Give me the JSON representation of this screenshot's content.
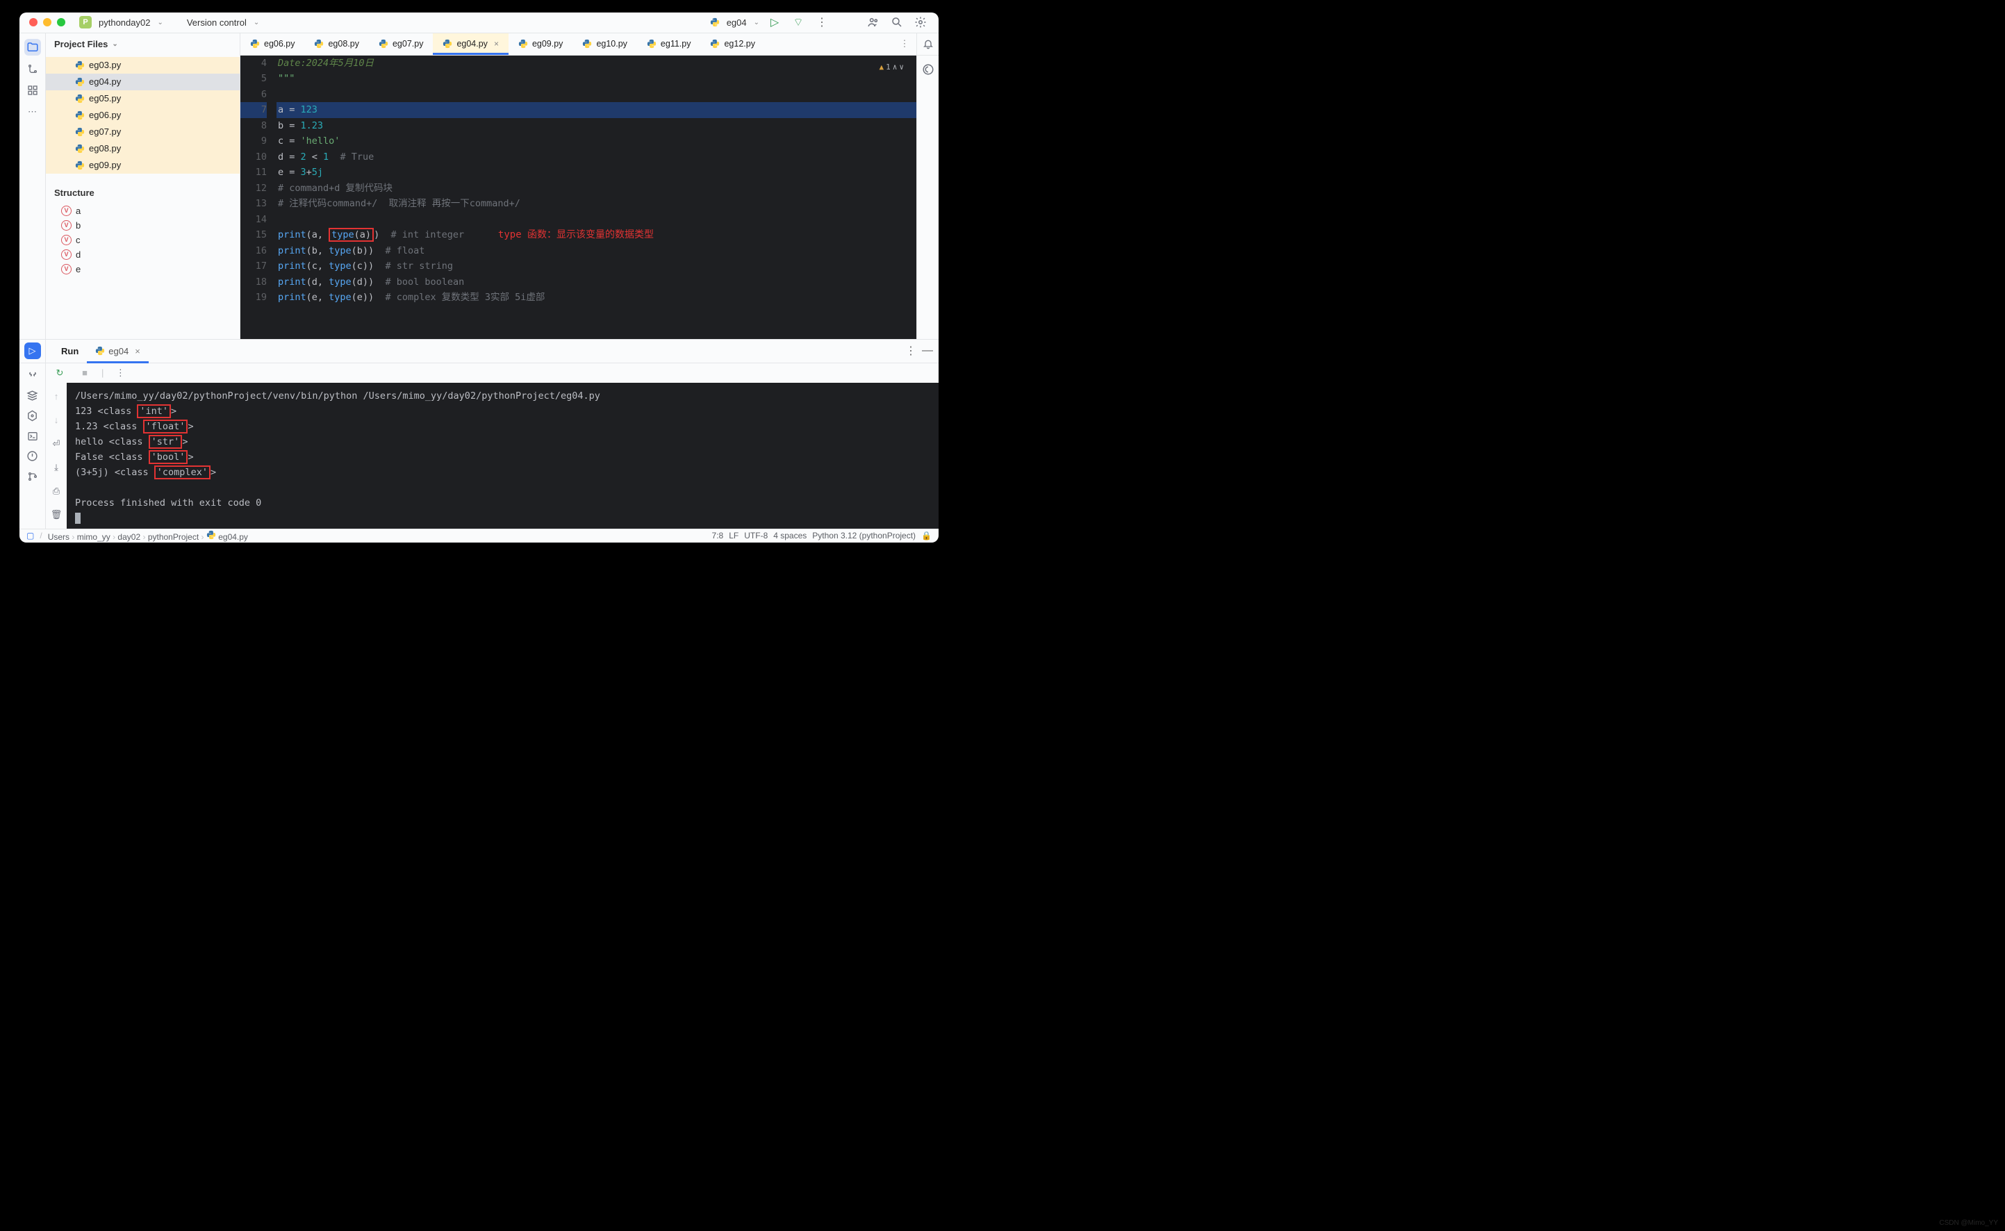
{
  "titlebar": {
    "project": "pythonday02",
    "version_control": "Version control",
    "current_file": "eg04"
  },
  "toolbar_icons": [
    "people",
    "search",
    "settings"
  ],
  "sidebar": {
    "header": "Project Files",
    "files": [
      "eg03.py",
      "eg04.py",
      "eg05.py",
      "eg06.py",
      "eg07.py",
      "eg08.py",
      "eg09.py"
    ],
    "selected_index": 1,
    "structure_header": "Structure",
    "structure_items": [
      "a",
      "b",
      "c",
      "d",
      "e"
    ]
  },
  "editor": {
    "tabs": [
      {
        "label": "eg06.py"
      },
      {
        "label": "eg08.py"
      },
      {
        "label": "eg07.py"
      },
      {
        "label": "eg04.py",
        "active": true,
        "close": true
      },
      {
        "label": "eg09.py"
      },
      {
        "label": "eg10.py"
      },
      {
        "label": "eg11.py"
      },
      {
        "label": "eg12.py"
      }
    ],
    "warning_count": "1",
    "lines": [
      {
        "n": 4,
        "html": "<span class='docstr'>Date:2024年5月10日</span>"
      },
      {
        "n": 5,
        "html": "<span class='str'>\"\"\"</span>"
      },
      {
        "n": 6,
        "html": ""
      },
      {
        "n": 7,
        "html": "a = <span class='num'>123</span>",
        "hl": true
      },
      {
        "n": 8,
        "html": "b = <span class='num'>1.23</span>"
      },
      {
        "n": 9,
        "html": "c = <span class='str'>'hello'</span>"
      },
      {
        "n": 10,
        "html": "d = <span class='num'>2</span> &lt; <span class='num'>1</span>  <span class='cmt'># True</span>"
      },
      {
        "n": 11,
        "html": "e = <span class='num'>3</span>+<span class='num'>5j</span>"
      },
      {
        "n": 12,
        "html": "<span class='cmt'># command+d 复制代码块</span>"
      },
      {
        "n": 13,
        "html": "<span class='cmt'># 注释代码command+/  取消注释 再按一下command+/</span>"
      },
      {
        "n": 14,
        "html": ""
      },
      {
        "n": 15,
        "html": "<span class='call'>print</span>(a, <span class='redbox'><span class='call'>type</span>(a)</span>)  <span class='cmt'># int integer</span>      <span class='anno'>type 函数：显示该变量的数据类型</span>"
      },
      {
        "n": 16,
        "html": "<span class='call'>print</span>(b, <span class='call'>type</span>(b))  <span class='cmt'># float</span>"
      },
      {
        "n": 17,
        "html": "<span class='call'>print</span>(c, <span class='call'>type</span>(c))  <span class='cmt'># str string</span>"
      },
      {
        "n": 18,
        "html": "<span class='call'>print</span>(d, <span class='call'>type</span>(d))  <span class='cmt'># bool boolean</span>"
      },
      {
        "n": 19,
        "html": "<span class='call'>print</span>(e, <span class='call'>type</span>(e))  <span class='cmt'># complex 复数类型 3实部 5i虚部</span>"
      }
    ]
  },
  "run_panel": {
    "title": "Run",
    "tab": "eg04",
    "console_lines": [
      "/Users/mimo_yy/day02/pythonProject/venv/bin/python /Users/mimo_yy/day02/pythonProject/eg04.py",
      "123 &lt;class <span class='redbox'>'int'</span>&gt;",
      "1.23 &lt;class <span class='redbox'>'float'</span>&gt;",
      "hello &lt;class <span class='redbox'>'str'</span>&gt;",
      "False &lt;class <span class='redbox'>'bool'</span>&gt;",
      "(3+5j) &lt;class <span class='redbox'>'complex'</span>&gt;",
      "",
      "Process finished with exit code 0",
      "<span style='background:#abb1b8;color:#1e1f22'>&nbsp;</span>"
    ]
  },
  "statusbar": {
    "breadcrumbs": [
      "Users",
      "mimo_yy",
      "day02",
      "pythonProject",
      "eg04.py"
    ],
    "cursor": "7:8",
    "lf": "LF",
    "enc": "UTF-8",
    "indent": "4 spaces",
    "sdk": "Python 3.12 (pythonProject)"
  },
  "watermark": "CSDN @Mimo_YY"
}
